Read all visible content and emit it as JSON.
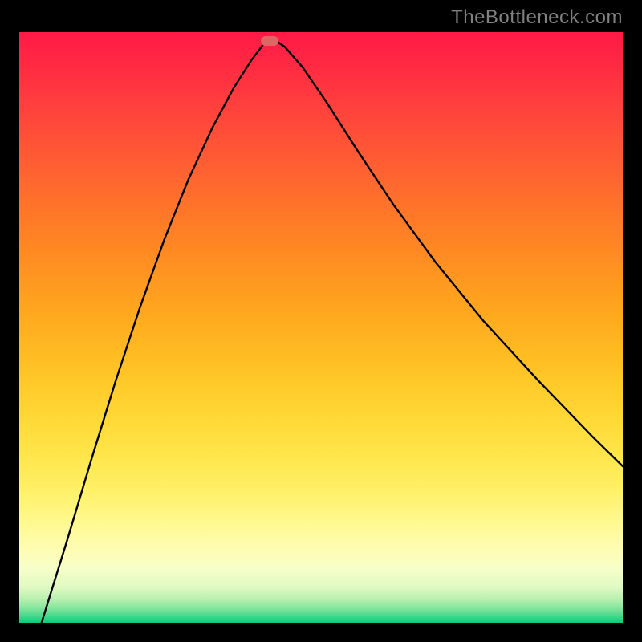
{
  "watermark": "TheBottleneck.com",
  "colors": {
    "marker": "#e06666",
    "curve": "#000000",
    "frame": "#000000"
  },
  "chart_data": {
    "type": "line",
    "title": "",
    "xlabel": "",
    "ylabel": "",
    "xlim": [
      0,
      1
    ],
    "ylim": [
      0,
      1
    ],
    "annotations": [],
    "gradient_bg": {
      "orientation": "vertical",
      "top_color": "#ff1946",
      "mid_color": "#ffda38",
      "bottom_color": "#0ccc7c"
    },
    "marker": {
      "x": 0.415,
      "y": 0.985
    },
    "series": [
      {
        "name": "curve",
        "x": [
          0.037,
          0.08,
          0.12,
          0.16,
          0.2,
          0.24,
          0.28,
          0.32,
          0.355,
          0.385,
          0.405,
          0.42,
          0.44,
          0.47,
          0.51,
          0.56,
          0.62,
          0.69,
          0.77,
          0.86,
          0.95,
          1.0
        ],
        "y": [
          0.0,
          0.142,
          0.278,
          0.41,
          0.534,
          0.648,
          0.75,
          0.838,
          0.905,
          0.953,
          0.98,
          0.989,
          0.975,
          0.94,
          0.88,
          0.8,
          0.708,
          0.61,
          0.51,
          0.41,
          0.315,
          0.265
        ]
      }
    ]
  }
}
